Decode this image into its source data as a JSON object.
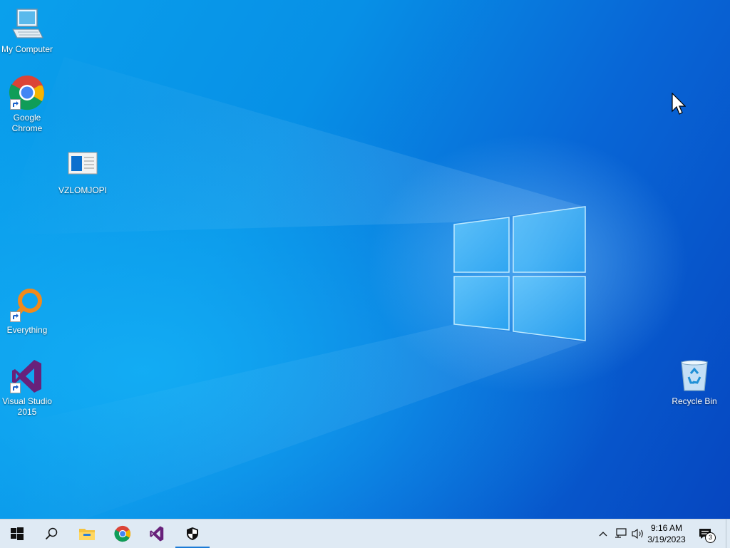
{
  "desktop": {
    "icons": [
      {
        "label": "My Computer",
        "icon": "computer-icon"
      },
      {
        "label": "Google Chrome",
        "icon": "chrome-icon",
        "shortcut": true
      },
      {
        "label": "VZLOMJOPI",
        "icon": "document-icon"
      },
      {
        "label": "Everything",
        "icon": "everything-search-icon",
        "shortcut": true
      },
      {
        "label": "Visual Studio 2015",
        "icon": "visual-studio-icon",
        "shortcut": true
      },
      {
        "label": "Recycle Bin",
        "icon": "recycle-bin-icon"
      }
    ],
    "colors": {
      "wallpaper_light": "#14b0f4",
      "wallpaper_dark": "#0646c0"
    }
  },
  "taskbar": {
    "buttons": [
      {
        "name": "Start",
        "icon": "windows-start-icon"
      },
      {
        "name": "Search",
        "icon": "search-icon"
      },
      {
        "name": "File Explorer",
        "icon": "folder-icon"
      },
      {
        "name": "Google Chrome",
        "icon": "chrome-icon"
      },
      {
        "name": "Visual Studio",
        "icon": "visual-studio-icon"
      },
      {
        "name": "Windows Security",
        "icon": "shield-icon",
        "active": true
      }
    ],
    "tray": {
      "icons": [
        "chevron-up-icon",
        "network-icon",
        "volume-icon"
      ],
      "time": "9:16 AM",
      "date": "3/19/2023",
      "notification_count": "3"
    },
    "background": "#dfeaf4"
  }
}
